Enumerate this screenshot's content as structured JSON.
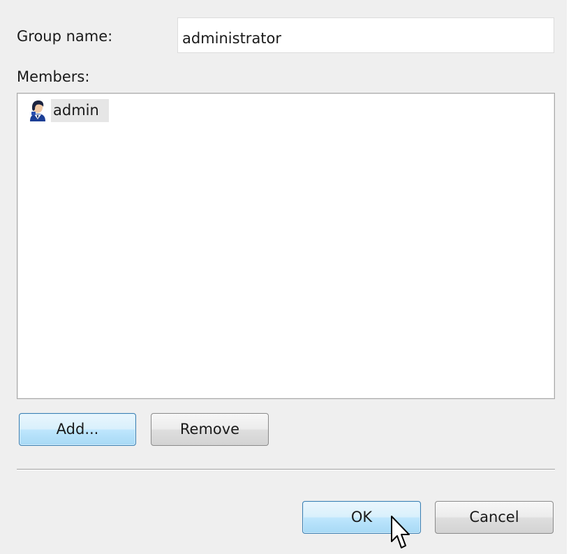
{
  "dialog": {
    "group_name_label": "Group name:",
    "group_name_value": "administrator",
    "members_label": "Members:",
    "members": [
      {
        "name": "admin",
        "icon": "user-icon"
      }
    ],
    "add_button": "Add...",
    "remove_button": "Remove",
    "ok_button": "OK",
    "cancel_button": "Cancel"
  },
  "colors": {
    "dialog_background": "#efefef",
    "focused_button_border": "#3c7fb1",
    "selected_item_background": "#e6e6e6"
  }
}
